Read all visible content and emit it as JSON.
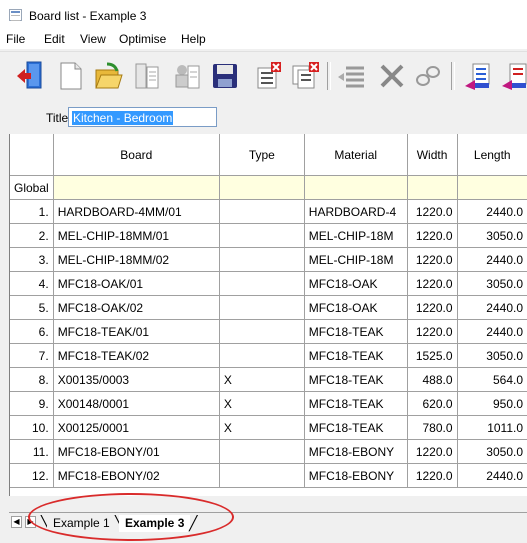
{
  "window": {
    "title": "Board list - Example 3"
  },
  "menu": [
    "File",
    "Edit",
    "View",
    "Optimise",
    "Help"
  ],
  "toolbar": {
    "buttons": [
      "exit-icon",
      "new-document-icon",
      "open-folder-icon",
      "board-list-icon",
      "parts-list-icon",
      "save-disk-icon",
      "delete-list-icon",
      "delete-multiple-icon",
      "align-list-icon",
      "cut-icon",
      "link-icon",
      "list-up-icon",
      "list-down-icon"
    ]
  },
  "form": {
    "title_label": "Title",
    "title_value": "Kitchen - Bedroom"
  },
  "grid": {
    "columns": [
      "",
      "Board",
      "Type",
      "Material",
      "Width",
      "Length"
    ],
    "global_label": "Global",
    "rows": [
      {
        "n": "1.",
        "board": "HARDBOARD-4MM/01",
        "type": "",
        "material": "HARDBOARD-4",
        "width": "1220.0",
        "length": "2440.0"
      },
      {
        "n": "2.",
        "board": "MEL-CHIP-18MM/01",
        "type": "",
        "material": "MEL-CHIP-18M",
        "width": "1220.0",
        "length": "3050.0"
      },
      {
        "n": "3.",
        "board": "MEL-CHIP-18MM/02",
        "type": "",
        "material": "MEL-CHIP-18M",
        "width": "1220.0",
        "length": "2440.0"
      },
      {
        "n": "4.",
        "board": "MFC18-OAK/01",
        "type": "",
        "material": "MFC18-OAK",
        "width": "1220.0",
        "length": "3050.0"
      },
      {
        "n": "5.",
        "board": "MFC18-OAK/02",
        "type": "",
        "material": "MFC18-OAK",
        "width": "1220.0",
        "length": "2440.0"
      },
      {
        "n": "6.",
        "board": "MFC18-TEAK/01",
        "type": "",
        "material": "MFC18-TEAK",
        "width": "1220.0",
        "length": "2440.0"
      },
      {
        "n": "7.",
        "board": "MFC18-TEAK/02",
        "type": "",
        "material": "MFC18-TEAK",
        "width": "1525.0",
        "length": "3050.0"
      },
      {
        "n": "8.",
        "board": "X00135/0003",
        "type": "X",
        "material": "MFC18-TEAK",
        "width": "488.0",
        "length": "564.0"
      },
      {
        "n": "9.",
        "board": "X00148/0001",
        "type": "X",
        "material": "MFC18-TEAK",
        "width": "620.0",
        "length": "950.0"
      },
      {
        "n": "10.",
        "board": "X00125/0001",
        "type": "X",
        "material": "MFC18-TEAK",
        "width": "780.0",
        "length": "1011.0"
      },
      {
        "n": "11.",
        "board": "MFC18-EBONY/01",
        "type": "",
        "material": "MFC18-EBONY",
        "width": "1220.0",
        "length": "3050.0"
      },
      {
        "n": "12.",
        "board": "MFC18-EBONY/02",
        "type": "",
        "material": "MFC18-EBONY",
        "width": "1220.0",
        "length": "2440.0"
      }
    ]
  },
  "sheets": {
    "tabs": [
      "Example 1",
      "Example 3"
    ],
    "active": "Example 3"
  },
  "colors": {
    "global_row": "#ffffe0",
    "selection": "#3399ff",
    "highlight_ellipse": "#d92b2b"
  }
}
